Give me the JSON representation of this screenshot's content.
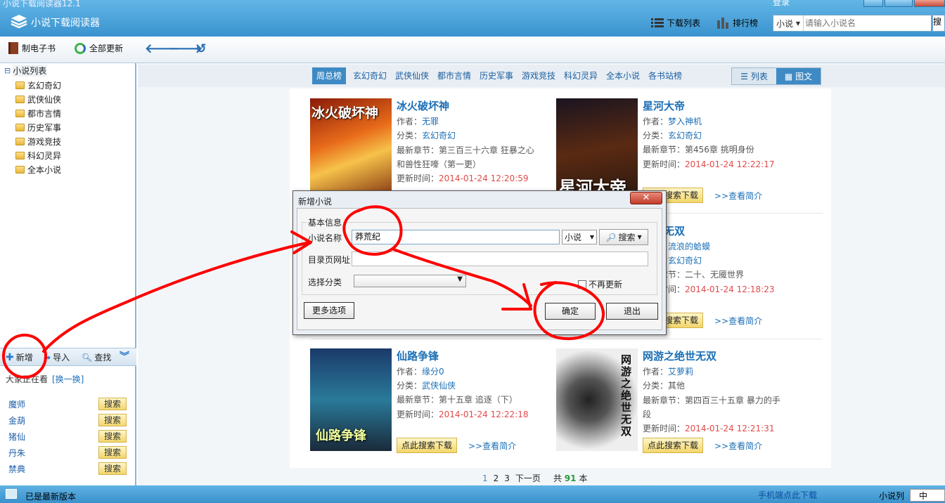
{
  "window": {
    "title": "小说下载阅读器12.1",
    "app_name": "小说下载阅读器",
    "login": "登录"
  },
  "header": {
    "download_list": "下载列表",
    "rank": "排行榜",
    "search": {
      "category": "小说",
      "placeholder": "请输入小说名",
      "button": "搜"
    }
  },
  "toolbar": {
    "make_ebook": "制电子书",
    "update_all": "全部更新"
  },
  "sidebar": {
    "root": "小说列表",
    "items": [
      "玄幻奇幻",
      "武侠仙侠",
      "都市言情",
      "历史军事",
      "游戏竞技",
      "科幻灵异",
      "全本小说"
    ],
    "actions": {
      "add": "新增",
      "import": "导入",
      "find": "查找"
    },
    "watching": {
      "title": "大家正在看",
      "swap": "[换一换]",
      "search_label": "搜索",
      "items": [
        "魔师",
        "金葫",
        "猪仙",
        "丹朱",
        "禁典"
      ]
    }
  },
  "tabs": [
    "周总榜",
    "玄幻奇幻",
    "武侠仙侠",
    "都市言情",
    "历史军事",
    "游戏竞技",
    "科幻灵异",
    "全本小说",
    "各书站榜"
  ],
  "view": {
    "list": "列表",
    "grid": "图文"
  },
  "labels": {
    "author": "作者：",
    "category": "分类：",
    "latest": "最新章节：",
    "updated": "更新时间：",
    "download": "点此搜索下载",
    "intro": ">>查看简介"
  },
  "books": [
    {
      "title": "冰火破坏神",
      "author": "无罪",
      "category": "玄幻奇幻",
      "latest": "第三百三十六章 狂暴之心和兽性狂嚎（第一更）",
      "time": "2014-01-24 12:20:59",
      "cover_text": "冰火破坏神"
    },
    {
      "title": "星河大帝",
      "author": "梦入神机",
      "category": "玄幻奇幻",
      "latest": "第456章 挑明身份",
      "time": "2014-01-24 12:22:17",
      "cover_text": "星河大帝"
    },
    {
      "title": "无双",
      "author": "流浪的蛤蟆",
      "category": "玄幻奇幻",
      "latest": "二十、无魇世界",
      "time": "2014-01-24 12:18:23",
      "cover_text": ""
    },
    {
      "title": "仙路争锋",
      "author": "缘分0",
      "category": "武侠仙侠",
      "latest": "第十五章 追逐（下）",
      "time": "2014-01-24 12:22:18",
      "cover_text": "仙路争锋"
    },
    {
      "title": "网游之绝世无双",
      "author": "艾萝莉",
      "category": "其他",
      "latest": "第四百三十五章 暴力的手段",
      "time": "2014-01-24 12:21:31",
      "cover_text": "网游之绝世无双"
    }
  ],
  "pager": {
    "pages": [
      "1",
      "2",
      "3"
    ],
    "next": "下一页",
    "total_prefix": "共",
    "total": "91",
    "total_suffix": "本"
  },
  "status": {
    "text": "已是最新版本",
    "phone": "手机端点此下载",
    "novel_list": "小说列",
    "ime": "中"
  },
  "dialog": {
    "title": "新增小说",
    "group": "基本信息",
    "name_label": "小说名称",
    "name_value": "莽荒纪",
    "type": "小说",
    "search": "搜索",
    "url_label": "目录页网址",
    "category_label": "选择分类",
    "no_update": "不再更新",
    "more": "更多选项",
    "ok": "确定",
    "exit": "退出"
  },
  "colors": {
    "accent": "#3f8ac4",
    "link": "#1b6fb5",
    "time": "#e24a4a",
    "annotation": "#ff0000"
  }
}
